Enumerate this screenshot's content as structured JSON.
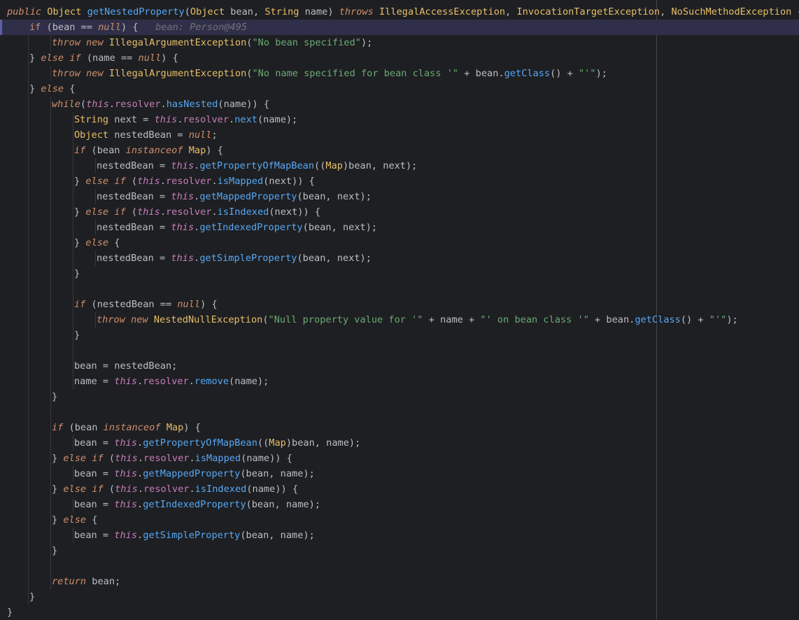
{
  "colors": {
    "background": "#1e1f22",
    "execution_line": "#2f2f49",
    "keyword": "#cf8e6d",
    "type": "#e8bf6a",
    "method": "#56a8f5",
    "string": "#6aab73",
    "this_field": "#c77dbb",
    "plain": "#bcbec4",
    "inline_hint": "#6f737a"
  },
  "lines": [
    {
      "indent": 0,
      "tokens": [
        [
          "kwi",
          "public"
        ],
        [
          "plain",
          " "
        ],
        [
          "type",
          "Object"
        ],
        [
          "plain",
          " "
        ],
        [
          "method",
          "getNestedProperty"
        ],
        [
          "plain",
          "("
        ],
        [
          "type",
          "Object"
        ],
        [
          "plain",
          " bean, "
        ],
        [
          "type",
          "String"
        ],
        [
          "plain",
          " name) "
        ],
        [
          "kwi",
          "throws"
        ],
        [
          "plain",
          " "
        ],
        [
          "type",
          "IllegalAccessException"
        ],
        [
          "plain",
          ", "
        ],
        [
          "type",
          "InvocationTargetException"
        ],
        [
          "plain",
          ", "
        ],
        [
          "type",
          "NoSuchMethodException"
        ],
        [
          "plain",
          " {"
        ]
      ]
    },
    {
      "indent": 1,
      "exec": true,
      "tokens": [
        [
          "kw",
          "if"
        ],
        [
          "plain",
          " (bean == "
        ],
        [
          "kwi",
          "null"
        ],
        [
          "plain",
          ") {"
        ],
        [
          "hint",
          "   bean: Person@495"
        ]
      ]
    },
    {
      "indent": 2,
      "tokens": [
        [
          "kwi",
          "throw"
        ],
        [
          "plain",
          " "
        ],
        [
          "kwi",
          "new"
        ],
        [
          "plain",
          " "
        ],
        [
          "type",
          "IllegalArgumentException"
        ],
        [
          "plain",
          "("
        ],
        [
          "str",
          "\"No bean specified\""
        ],
        [
          "plain",
          ");"
        ]
      ]
    },
    {
      "indent": 1,
      "tokens": [
        [
          "plain",
          "} "
        ],
        [
          "kwi",
          "else"
        ],
        [
          "plain",
          " "
        ],
        [
          "kwi",
          "if"
        ],
        [
          "plain",
          " (name == "
        ],
        [
          "kwi",
          "null"
        ],
        [
          "plain",
          ") {"
        ]
      ]
    },
    {
      "indent": 2,
      "tokens": [
        [
          "kwi",
          "throw"
        ],
        [
          "plain",
          " "
        ],
        [
          "kwi",
          "new"
        ],
        [
          "plain",
          " "
        ],
        [
          "type",
          "IllegalArgumentException"
        ],
        [
          "plain",
          "("
        ],
        [
          "str",
          "\"No name specified for bean class '\""
        ],
        [
          "plain",
          " + bean."
        ],
        [
          "method",
          "getClass"
        ],
        [
          "plain",
          "() + "
        ],
        [
          "str",
          "\"'\""
        ],
        [
          "plain",
          ");"
        ]
      ]
    },
    {
      "indent": 1,
      "tokens": [
        [
          "plain",
          "} "
        ],
        [
          "kwi",
          "else"
        ],
        [
          "plain",
          " {"
        ]
      ]
    },
    {
      "indent": 2,
      "tokens": [
        [
          "kwi",
          "while"
        ],
        [
          "plain",
          "("
        ],
        [
          "this",
          "this"
        ],
        [
          "plain",
          "."
        ],
        [
          "field",
          "resolver"
        ],
        [
          "plain",
          "."
        ],
        [
          "method",
          "hasNested"
        ],
        [
          "plain",
          "(name)) {"
        ]
      ]
    },
    {
      "indent": 3,
      "tokens": [
        [
          "type",
          "String"
        ],
        [
          "plain",
          " next = "
        ],
        [
          "this",
          "this"
        ],
        [
          "plain",
          "."
        ],
        [
          "field",
          "resolver"
        ],
        [
          "plain",
          "."
        ],
        [
          "method",
          "next"
        ],
        [
          "plain",
          "(name);"
        ]
      ]
    },
    {
      "indent": 3,
      "tokens": [
        [
          "type",
          "Object"
        ],
        [
          "plain",
          " nestedBean = "
        ],
        [
          "kwi",
          "null"
        ],
        [
          "plain",
          ";"
        ]
      ]
    },
    {
      "indent": 3,
      "tokens": [
        [
          "kwi",
          "if"
        ],
        [
          "plain",
          " (bean "
        ],
        [
          "kwi",
          "instanceof"
        ],
        [
          "plain",
          " "
        ],
        [
          "type",
          "Map"
        ],
        [
          "plain",
          ") {"
        ]
      ]
    },
    {
      "indent": 4,
      "tokens": [
        [
          "plain",
          "nestedBean = "
        ],
        [
          "this",
          "this"
        ],
        [
          "plain",
          "."
        ],
        [
          "method",
          "getPropertyOfMapBean"
        ],
        [
          "plain",
          "(("
        ],
        [
          "type",
          "Map"
        ],
        [
          "plain",
          ")bean, next);"
        ]
      ]
    },
    {
      "indent": 3,
      "tokens": [
        [
          "plain",
          "} "
        ],
        [
          "kwi",
          "else"
        ],
        [
          "plain",
          " "
        ],
        [
          "kwi",
          "if"
        ],
        [
          "plain",
          " ("
        ],
        [
          "this",
          "this"
        ],
        [
          "plain",
          "."
        ],
        [
          "field",
          "resolver"
        ],
        [
          "plain",
          "."
        ],
        [
          "method",
          "isMapped"
        ],
        [
          "plain",
          "(next)) {"
        ]
      ]
    },
    {
      "indent": 4,
      "tokens": [
        [
          "plain",
          "nestedBean = "
        ],
        [
          "this",
          "this"
        ],
        [
          "plain",
          "."
        ],
        [
          "method",
          "getMappedProperty"
        ],
        [
          "plain",
          "(bean, next);"
        ]
      ]
    },
    {
      "indent": 3,
      "tokens": [
        [
          "plain",
          "} "
        ],
        [
          "kwi",
          "else"
        ],
        [
          "plain",
          " "
        ],
        [
          "kwi",
          "if"
        ],
        [
          "plain",
          " ("
        ],
        [
          "this",
          "this"
        ],
        [
          "plain",
          "."
        ],
        [
          "field",
          "resolver"
        ],
        [
          "plain",
          "."
        ],
        [
          "method",
          "isIndexed"
        ],
        [
          "plain",
          "(next)) {"
        ]
      ]
    },
    {
      "indent": 4,
      "tokens": [
        [
          "plain",
          "nestedBean = "
        ],
        [
          "this",
          "this"
        ],
        [
          "plain",
          "."
        ],
        [
          "method",
          "getIndexedProperty"
        ],
        [
          "plain",
          "(bean, next);"
        ]
      ]
    },
    {
      "indent": 3,
      "tokens": [
        [
          "plain",
          "} "
        ],
        [
          "kwi",
          "else"
        ],
        [
          "plain",
          " {"
        ]
      ]
    },
    {
      "indent": 4,
      "tokens": [
        [
          "plain",
          "nestedBean = "
        ],
        [
          "this",
          "this"
        ],
        [
          "plain",
          "."
        ],
        [
          "method",
          "getSimpleProperty"
        ],
        [
          "plain",
          "(bean, next);"
        ]
      ]
    },
    {
      "indent": 3,
      "tokens": [
        [
          "plain",
          "}"
        ]
      ]
    },
    {
      "indent": 0,
      "tokens": []
    },
    {
      "indent": 3,
      "tokens": [
        [
          "kwi",
          "if"
        ],
        [
          "plain",
          " (nestedBean == "
        ],
        [
          "kwi",
          "null"
        ],
        [
          "plain",
          ") {"
        ]
      ]
    },
    {
      "indent": 4,
      "tokens": [
        [
          "kwi",
          "throw"
        ],
        [
          "plain",
          " "
        ],
        [
          "kwi",
          "new"
        ],
        [
          "plain",
          " "
        ],
        [
          "type",
          "NestedNullException"
        ],
        [
          "plain",
          "("
        ],
        [
          "str",
          "\"Null property value for '\""
        ],
        [
          "plain",
          " + name + "
        ],
        [
          "str",
          "\"' on bean class '\""
        ],
        [
          "plain",
          " + bean."
        ],
        [
          "method",
          "getClass"
        ],
        [
          "plain",
          "() + "
        ],
        [
          "str",
          "\"'\""
        ],
        [
          "plain",
          ");"
        ]
      ]
    },
    {
      "indent": 3,
      "tokens": [
        [
          "plain",
          "}"
        ]
      ]
    },
    {
      "indent": 0,
      "tokens": []
    },
    {
      "indent": 3,
      "tokens": [
        [
          "plain",
          "bean = nestedBean;"
        ]
      ]
    },
    {
      "indent": 3,
      "tokens": [
        [
          "plain",
          "name = "
        ],
        [
          "this",
          "this"
        ],
        [
          "plain",
          "."
        ],
        [
          "field",
          "resolver"
        ],
        [
          "plain",
          "."
        ],
        [
          "method",
          "remove"
        ],
        [
          "plain",
          "(name);"
        ]
      ]
    },
    {
      "indent": 2,
      "tokens": [
        [
          "plain",
          "}"
        ]
      ]
    },
    {
      "indent": 0,
      "tokens": []
    },
    {
      "indent": 2,
      "tokens": [
        [
          "kwi",
          "if"
        ],
        [
          "plain",
          " (bean "
        ],
        [
          "kwi",
          "instanceof"
        ],
        [
          "plain",
          " "
        ],
        [
          "type",
          "Map"
        ],
        [
          "plain",
          ") {"
        ]
      ]
    },
    {
      "indent": 3,
      "tokens": [
        [
          "plain",
          "bean = "
        ],
        [
          "this",
          "this"
        ],
        [
          "plain",
          "."
        ],
        [
          "method",
          "getPropertyOfMapBean"
        ],
        [
          "plain",
          "(("
        ],
        [
          "type",
          "Map"
        ],
        [
          "plain",
          ")bean, name);"
        ]
      ]
    },
    {
      "indent": 2,
      "tokens": [
        [
          "plain",
          "} "
        ],
        [
          "kwi",
          "else"
        ],
        [
          "plain",
          " "
        ],
        [
          "kwi",
          "if"
        ],
        [
          "plain",
          " ("
        ],
        [
          "this",
          "this"
        ],
        [
          "plain",
          "."
        ],
        [
          "field",
          "resolver"
        ],
        [
          "plain",
          "."
        ],
        [
          "method",
          "isMapped"
        ],
        [
          "plain",
          "(name)) {"
        ]
      ]
    },
    {
      "indent": 3,
      "tokens": [
        [
          "plain",
          "bean = "
        ],
        [
          "this",
          "this"
        ],
        [
          "plain",
          "."
        ],
        [
          "method",
          "getMappedProperty"
        ],
        [
          "plain",
          "(bean, name);"
        ]
      ]
    },
    {
      "indent": 2,
      "tokens": [
        [
          "plain",
          "} "
        ],
        [
          "kwi",
          "else"
        ],
        [
          "plain",
          " "
        ],
        [
          "kwi",
          "if"
        ],
        [
          "plain",
          " ("
        ],
        [
          "this",
          "this"
        ],
        [
          "plain",
          "."
        ],
        [
          "field",
          "resolver"
        ],
        [
          "plain",
          "."
        ],
        [
          "method",
          "isIndexed"
        ],
        [
          "plain",
          "(name)) {"
        ]
      ]
    },
    {
      "indent": 3,
      "tokens": [
        [
          "plain",
          "bean = "
        ],
        [
          "this",
          "this"
        ],
        [
          "plain",
          "."
        ],
        [
          "method",
          "getIndexedProperty"
        ],
        [
          "plain",
          "(bean, name);"
        ]
      ]
    },
    {
      "indent": 2,
      "tokens": [
        [
          "plain",
          "} "
        ],
        [
          "kwi",
          "else"
        ],
        [
          "plain",
          " {"
        ]
      ]
    },
    {
      "indent": 3,
      "tokens": [
        [
          "plain",
          "bean = "
        ],
        [
          "this",
          "this"
        ],
        [
          "plain",
          "."
        ],
        [
          "method",
          "getSimpleProperty"
        ],
        [
          "plain",
          "(bean, name);"
        ]
      ]
    },
    {
      "indent": 2,
      "tokens": [
        [
          "plain",
          "}"
        ]
      ]
    },
    {
      "indent": 0,
      "tokens": []
    },
    {
      "indent": 2,
      "tokens": [
        [
          "kwi",
          "return"
        ],
        [
          "plain",
          " bean;"
        ]
      ]
    },
    {
      "indent": 1,
      "tokens": [
        [
          "plain",
          "}"
        ]
      ]
    },
    {
      "indent": 0,
      "tokens": [
        [
          "plain",
          "}"
        ]
      ]
    }
  ]
}
